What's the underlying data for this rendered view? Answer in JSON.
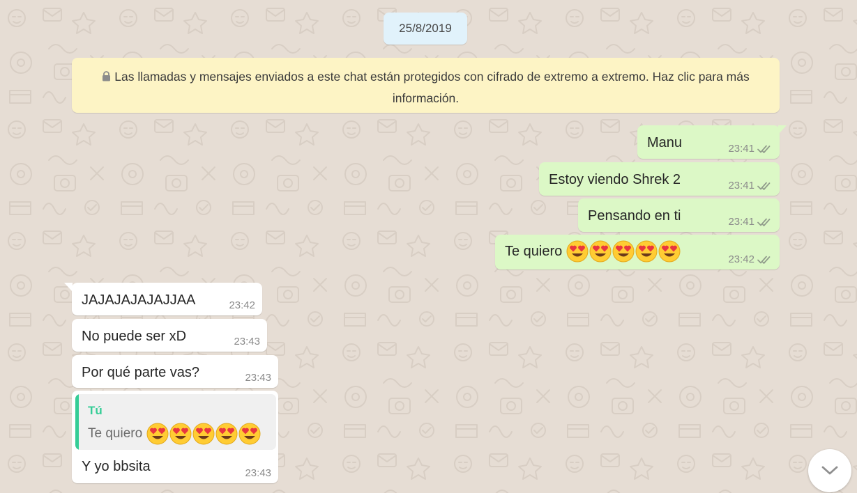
{
  "chat": {
    "date_divider": "25/8/2019",
    "encryption_notice": "Las llamadas y mensajes enviados a este chat están protegidos con cifrado de extremo a extremo. Haz clic para más información.",
    "messages": [
      {
        "direction": "out",
        "text": "Manu",
        "time": "23:41",
        "status": "read"
      },
      {
        "direction": "out",
        "text": "Estoy viendo Shrek 2",
        "time": "23:41",
        "status": "read"
      },
      {
        "direction": "out",
        "text": "Pensando en ti",
        "time": "23:41",
        "status": "read"
      },
      {
        "direction": "out",
        "text": "Te quiero",
        "emoji": "heart-eyes x5",
        "time": "23:42",
        "status": "read"
      },
      {
        "direction": "in",
        "text": "JAJAJAJAJAJJAA",
        "time": "23:42"
      },
      {
        "direction": "in",
        "text": "No puede ser xD",
        "time": "23:43"
      },
      {
        "direction": "in",
        "text": "Por qué parte vas?",
        "time": "23:43"
      },
      {
        "direction": "in",
        "text": "Y yo bbsita",
        "time": "23:43",
        "quoted": {
          "author": "Tú",
          "text": "Te quiero",
          "emoji": "heart-eyes x5"
        }
      }
    ]
  },
  "colors": {
    "outgoing_bubble": "#dcf8c6",
    "incoming_bubble": "#ffffff",
    "encryption_notice_bg": "#fdf4c5",
    "date_pill_bg": "#e1f2fb",
    "quote_accent": "#35cd96",
    "chat_background": "#e6ddd4"
  },
  "icons": {
    "lock": "lock-icon",
    "read_receipt": "double-check-icon",
    "emoji": "heart-eyes-emoji",
    "scroll_down": "chevron-down-icon"
  }
}
